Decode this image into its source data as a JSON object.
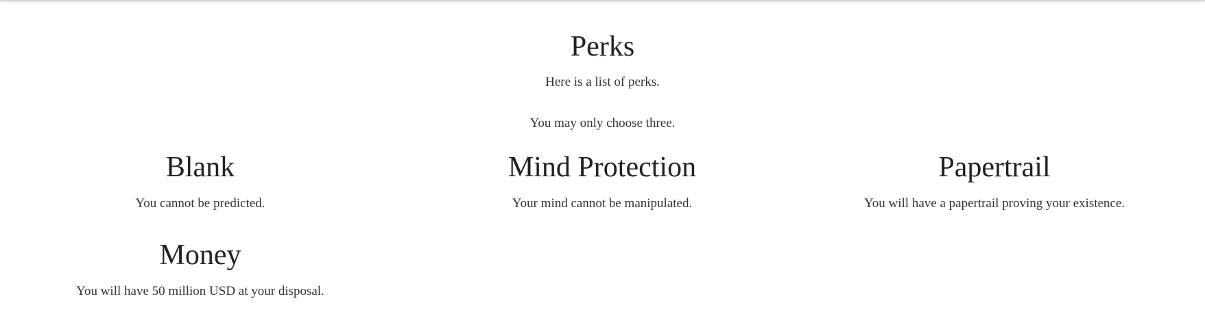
{
  "intro": {
    "title": "Perks",
    "subtitle_1": "Here is a list of perks.",
    "subtitle_2": "You may only choose three."
  },
  "perks": [
    {
      "name": "Blank",
      "description": "You cannot be predicted."
    },
    {
      "name": "Mind Protection",
      "description": "Your mind cannot be manipulated."
    },
    {
      "name": "Papertrail",
      "description": "You will have a papertrail proving your existence."
    },
    {
      "name": "Money",
      "description": "You will have 50 million USD at your disposal."
    }
  ]
}
